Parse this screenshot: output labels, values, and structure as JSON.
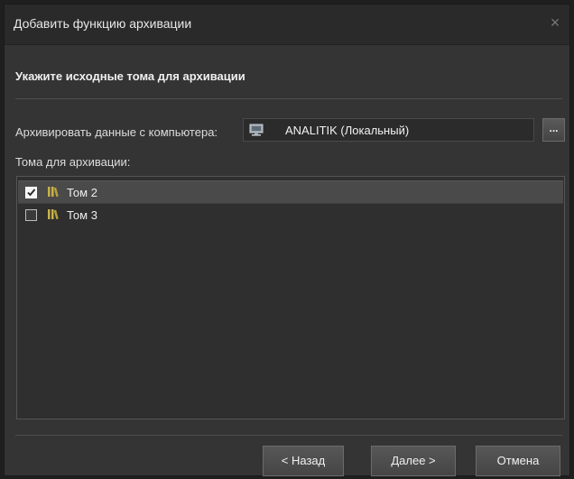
{
  "window": {
    "title": "Добавить функцию архивации",
    "close_symbol": "×"
  },
  "section": {
    "heading": "Укажите исходные тома для архивации"
  },
  "source": {
    "label": "Архивировать данные с компьютера:",
    "computer_icon": "computer-icon",
    "computer_value": "ANALITIK (Локальный)",
    "browse_label": "..."
  },
  "volumes": {
    "label": "Тома для архивации:",
    "items": [
      {
        "name": "Том 2",
        "checked": true,
        "selected": true,
        "icon": "volume-icon"
      },
      {
        "name": "Том 3",
        "checked": false,
        "selected": false,
        "icon": "volume-icon"
      }
    ]
  },
  "buttons": {
    "back": "< Назад",
    "next": "Далее >",
    "cancel": "Отмена"
  },
  "colors": {
    "window_bg": "#343434",
    "titlebar_bg": "#2a2a2a",
    "list_bg": "#2f2f2f",
    "selected_row": "#4a4a4a",
    "text": "#e6e6e6"
  }
}
